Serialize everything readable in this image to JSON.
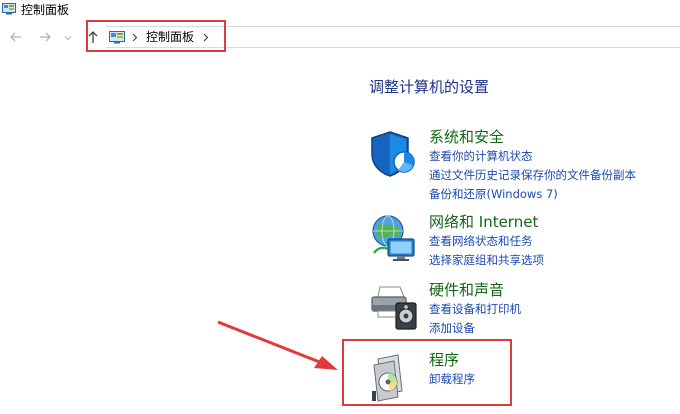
{
  "window": {
    "title": "控制面板"
  },
  "navigation": {
    "back_icon": "arrow-left-icon",
    "forward_icon": "arrow-right-icon",
    "history_icon": "chevron-down-icon",
    "up_icon": "arrow-up-icon",
    "breadcrumb": [
      "控制面板"
    ]
  },
  "main": {
    "title": "调整计算机的设置",
    "categories": [
      {
        "icon": "shield-icon",
        "title": "系统和安全",
        "links": [
          "查看你的计算机状态",
          "通过文件历史记录保存你的文件备份副本",
          "备份和还原(Windows 7)"
        ]
      },
      {
        "icon": "network-globe-icon",
        "title": "网络和 Internet",
        "links": [
          "查看网络状态和任务",
          "选择家庭组和共享选项"
        ]
      },
      {
        "icon": "printer-icon",
        "title": "硬件和声音",
        "links": [
          "查看设备和打印机",
          "添加设备"
        ]
      },
      {
        "icon": "programs-disc-icon",
        "title": "程序",
        "links": [
          "卸载程序"
        ]
      }
    ]
  },
  "annotations": {
    "highlight_color": "#e03a3a",
    "arrow_color": "#e03a3a"
  },
  "colors": {
    "title_blue": "#1e3287",
    "category_green": "#146614",
    "link_blue": "#1c4bb0"
  }
}
